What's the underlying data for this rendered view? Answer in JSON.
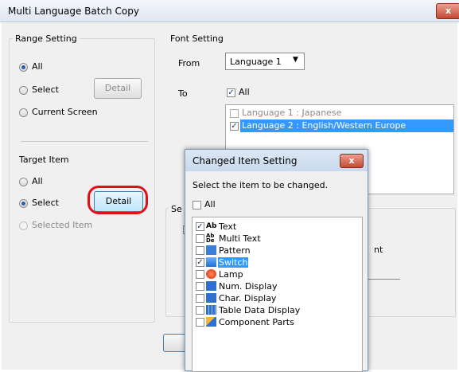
{
  "window": {
    "title": "Multi Language Batch Copy",
    "close_glyph": "x"
  },
  "range_setting": {
    "label": "Range Setting",
    "all": "All",
    "select": "Select",
    "detail": "Detail",
    "current_screen": "Current Screen"
  },
  "target_item": {
    "label": "Target Item",
    "all": "All",
    "select": "Select",
    "detail": "Detail",
    "selected_item": "Selected Item"
  },
  "font_setting": {
    "label": "Font Setting",
    "from_label": "From",
    "from_value": "Language 1",
    "to_label": "To",
    "to_all": "All",
    "languages": [
      "Language 1 : Japanese",
      "Language 2 : English/Western Europe"
    ]
  },
  "behind_fragments": {
    "se": "Se",
    "nt": "nt"
  },
  "dialog": {
    "title": "Changed Item Setting",
    "close_glyph": "x",
    "instruction": "Select the item to be changed.",
    "all": "All",
    "items": [
      {
        "label": "Text",
        "icon": "text-icon",
        "checked": true,
        "selected": false
      },
      {
        "label": "Multi Text",
        "icon": "multi-text-icon",
        "checked": false,
        "selected": false
      },
      {
        "label": "Pattern",
        "icon": "pattern-icon",
        "checked": false,
        "selected": false
      },
      {
        "label": "Switch",
        "icon": "switch-icon",
        "checked": true,
        "selected": true
      },
      {
        "label": "Lamp",
        "icon": "lamp-icon",
        "checked": false,
        "selected": false
      },
      {
        "label": "Num. Display",
        "icon": "num-display-icon",
        "checked": false,
        "selected": false
      },
      {
        "label": "Char. Display",
        "icon": "char-display-icon",
        "checked": false,
        "selected": false
      },
      {
        "label": "Table Data Display",
        "icon": "table-data-display-icon",
        "checked": false,
        "selected": false
      },
      {
        "label": "Component Parts",
        "icon": "component-parts-icon",
        "checked": false,
        "selected": false
      }
    ]
  },
  "colors": {
    "highlight": "#3399ff",
    "annotation": "#e0101a",
    "close": "#c64a32"
  }
}
